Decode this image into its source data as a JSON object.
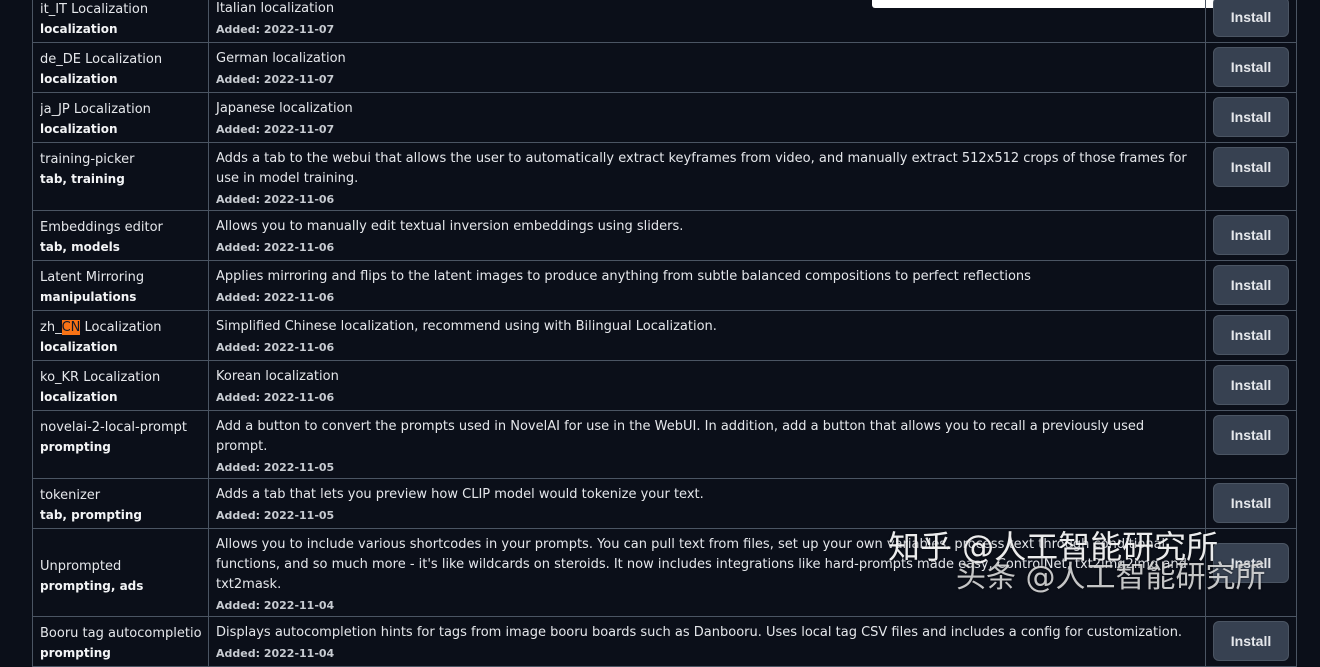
{
  "extensions": [
    {
      "name": "it_IT Localization",
      "tags": "localization",
      "description": "Italian localization",
      "added": "Added: 2022-11-07",
      "button": "Install"
    },
    {
      "name": "de_DE Localization",
      "tags": "localization",
      "description": "German localization",
      "added": "Added: 2022-11-07",
      "button": "Install"
    },
    {
      "name": "ja_JP Localization",
      "tags": "localization",
      "description": "Japanese localization",
      "added": "Added: 2022-11-07",
      "button": "Install"
    },
    {
      "name": "training-picker",
      "tags": "tab, training",
      "description": "Adds a tab to the webui that allows the user to automatically extract keyframes from video, and manually extract 512x512 crops of those frames for use in model training.",
      "added": "Added: 2022-11-06",
      "button": "Install"
    },
    {
      "name": "Embeddings editor",
      "tags": "tab, models",
      "description": "Allows you to manually edit textual inversion embeddings using sliders.",
      "added": "Added: 2022-11-06",
      "button": "Install"
    },
    {
      "name": "Latent Mirroring",
      "tags": "manipulations",
      "description": "Applies mirroring and flips to the latent images to produce anything from subtle balanced compositions to perfect reflections",
      "added": "Added: 2022-11-06",
      "button": "Install"
    },
    {
      "name_prefix": "zh_",
      "name_highlight": "CN",
      "name_suffix": " Localization",
      "tags": "localization",
      "description": "Simplified Chinese localization, recommend using with Bilingual Localization.",
      "added": "Added: 2022-11-06",
      "button": "Install"
    },
    {
      "name": "ko_KR Localization",
      "tags": "localization",
      "description": "Korean localization",
      "added": "Added: 2022-11-06",
      "button": "Install"
    },
    {
      "name": "novelai-2-local-prompt",
      "tags": "prompting",
      "description": "Add a button to convert the prompts used in NovelAI for use in the WebUI. In addition, add a button that allows you to recall a previously used prompt.",
      "added": "Added: 2022-11-05",
      "button": "Install"
    },
    {
      "name": "tokenizer",
      "tags": "tab, prompting",
      "description": "Adds a tab that lets you preview how CLIP model would tokenize your text.",
      "added": "Added: 2022-11-05",
      "button": "Install"
    },
    {
      "name": "Unprompted",
      "tags": "prompting, ads",
      "description": "Allows you to include various shortcodes in your prompts. You can pull text from files, set up your own variables, process text through conditional functions, and so much more - it's like wildcards on steroids. It now includes integrations like hard-prompts made easy, ControlNet, txt2img2img and txt2mask.",
      "added": "Added: 2022-11-04",
      "button": "Install"
    },
    {
      "name": "Booru tag autocompletion",
      "tags": "prompting",
      "description": "Displays autocompletion hints for tags from image booru boards such as Danbooru. Uses local tag CSV files and includes a config for customization.",
      "added": "Added: 2022-11-04",
      "button": "Install"
    }
  ],
  "watermark": {
    "line1": "知乎 @人工智能研究所",
    "line2": "头条 @人工智能研究所"
  }
}
